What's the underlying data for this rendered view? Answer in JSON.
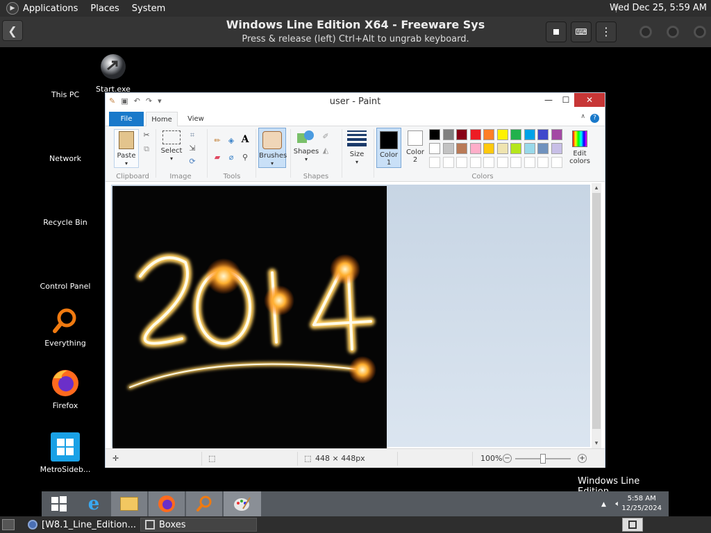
{
  "gnome_top": {
    "menus": [
      "Applications",
      "Places",
      "System"
    ],
    "clock": "Wed Dec 25,  5:59 AM"
  },
  "boxes_header": {
    "title": "Windows Line Edition X64 - Freeware Sys",
    "hint": "Press & release (left) Ctrl+Alt to ungrab keyboard."
  },
  "desktop": {
    "icons": [
      {
        "label": "This PC",
        "icon": "this-pc-icon"
      },
      {
        "label": "Start.exe",
        "icon": "start-exe-icon"
      },
      {
        "label": "Network",
        "icon": "network-icon"
      },
      {
        "label": "Recycle Bin",
        "icon": "recycle-bin-icon"
      },
      {
        "label": "Control Panel",
        "icon": "control-panel-icon"
      },
      {
        "label": "Everything",
        "icon": "everything-search-icon"
      },
      {
        "label": "Firefox",
        "icon": "firefox-icon"
      },
      {
        "label": "MetroSideb...",
        "icon": "metro-sidebar-icon"
      }
    ],
    "watermark": "Windows Line Edition"
  },
  "paint": {
    "title": "user - Paint",
    "tabs": [
      "File",
      "Home",
      "View"
    ],
    "groups": {
      "clipboard": {
        "label": "Clipboard",
        "paste": "Paste"
      },
      "image": {
        "label": "Image",
        "select": "Select"
      },
      "tools": {
        "label": "Tools"
      },
      "brushes": {
        "label": "Brushes"
      },
      "shapes": {
        "label": "Shapes",
        "shapes": "Shapes"
      },
      "size": {
        "label": "Size"
      },
      "colors": {
        "label": "Colors",
        "color1_line1": "Color",
        "color1_line2": "1",
        "color2_line1": "Color",
        "color2_line2": "2",
        "edit_line1": "Edit",
        "edit_line2": "colors",
        "color1_value": "#000000",
        "color2_value": "#ffffff",
        "palette_row1": [
          "#000000",
          "#7f7f7f",
          "#880015",
          "#ed1c24",
          "#ff7f27",
          "#fff200",
          "#22b14c",
          "#00a2e8",
          "#3f48cc",
          "#a349a4"
        ],
        "palette_row2": [
          "#ffffff",
          "#c3c3c3",
          "#b97a57",
          "#ffaec9",
          "#ffc90e",
          "#efe4b0",
          "#b5e61d",
          "#99d9ea",
          "#7092be",
          "#c8bfe7"
        ],
        "palette_row3": [
          "#ffffff",
          "#ffffff",
          "#ffffff",
          "#ffffff",
          "#ffffff",
          "#ffffff",
          "#ffffff",
          "#ffffff",
          "#ffffff",
          "#ffffff"
        ]
      }
    },
    "canvas_image_text": "2014",
    "status": {
      "dimensions": "448 × 448px",
      "zoom": "100%"
    }
  },
  "taskbar": {
    "time": "5:58 AM",
    "date": "12/25/2024",
    "items": [
      "start-icon",
      "internet-explorer-icon",
      "file-explorer-icon",
      "firefox-icon",
      "everything-search-icon",
      "paint-icon"
    ]
  },
  "gnome_bottom": {
    "tasks": [
      {
        "label": "[W8.1_Line_Edition...",
        "icon": "browser-icon"
      },
      {
        "label": "Boxes",
        "icon": "boxes-icon"
      }
    ]
  }
}
